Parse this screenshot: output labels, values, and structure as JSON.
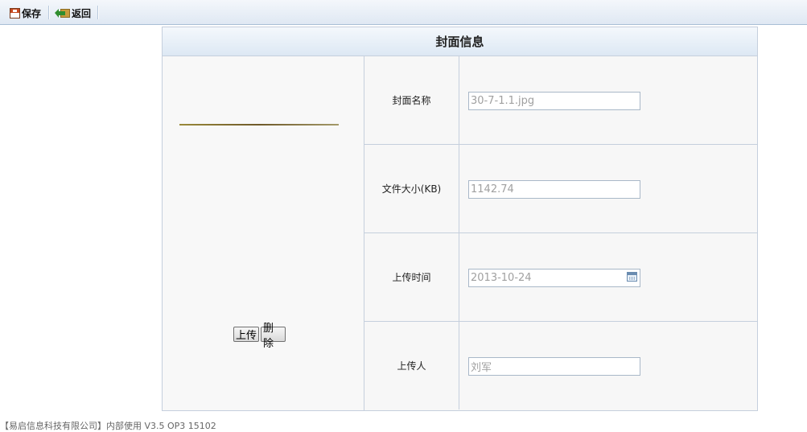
{
  "toolbar": {
    "save_label": "保存",
    "back_label": "返回",
    "save_icon": "save-icon",
    "back_icon": "back-icon"
  },
  "panel": {
    "title": "封面信息",
    "upload_label": "上传",
    "delete_label": "删除",
    "fields": [
      {
        "label": "封面名称",
        "value": "30-7-1.1.jpg"
      },
      {
        "label": "文件大小(KB)",
        "value": "1142.74"
      },
      {
        "label": "上传时间",
        "value": "2013-10-24"
      },
      {
        "label": "上传人",
        "value": "刘军"
      }
    ]
  },
  "footer": {
    "text": "【易启信息科技有限公司】内部使用 V3.5 OP3 15102"
  }
}
